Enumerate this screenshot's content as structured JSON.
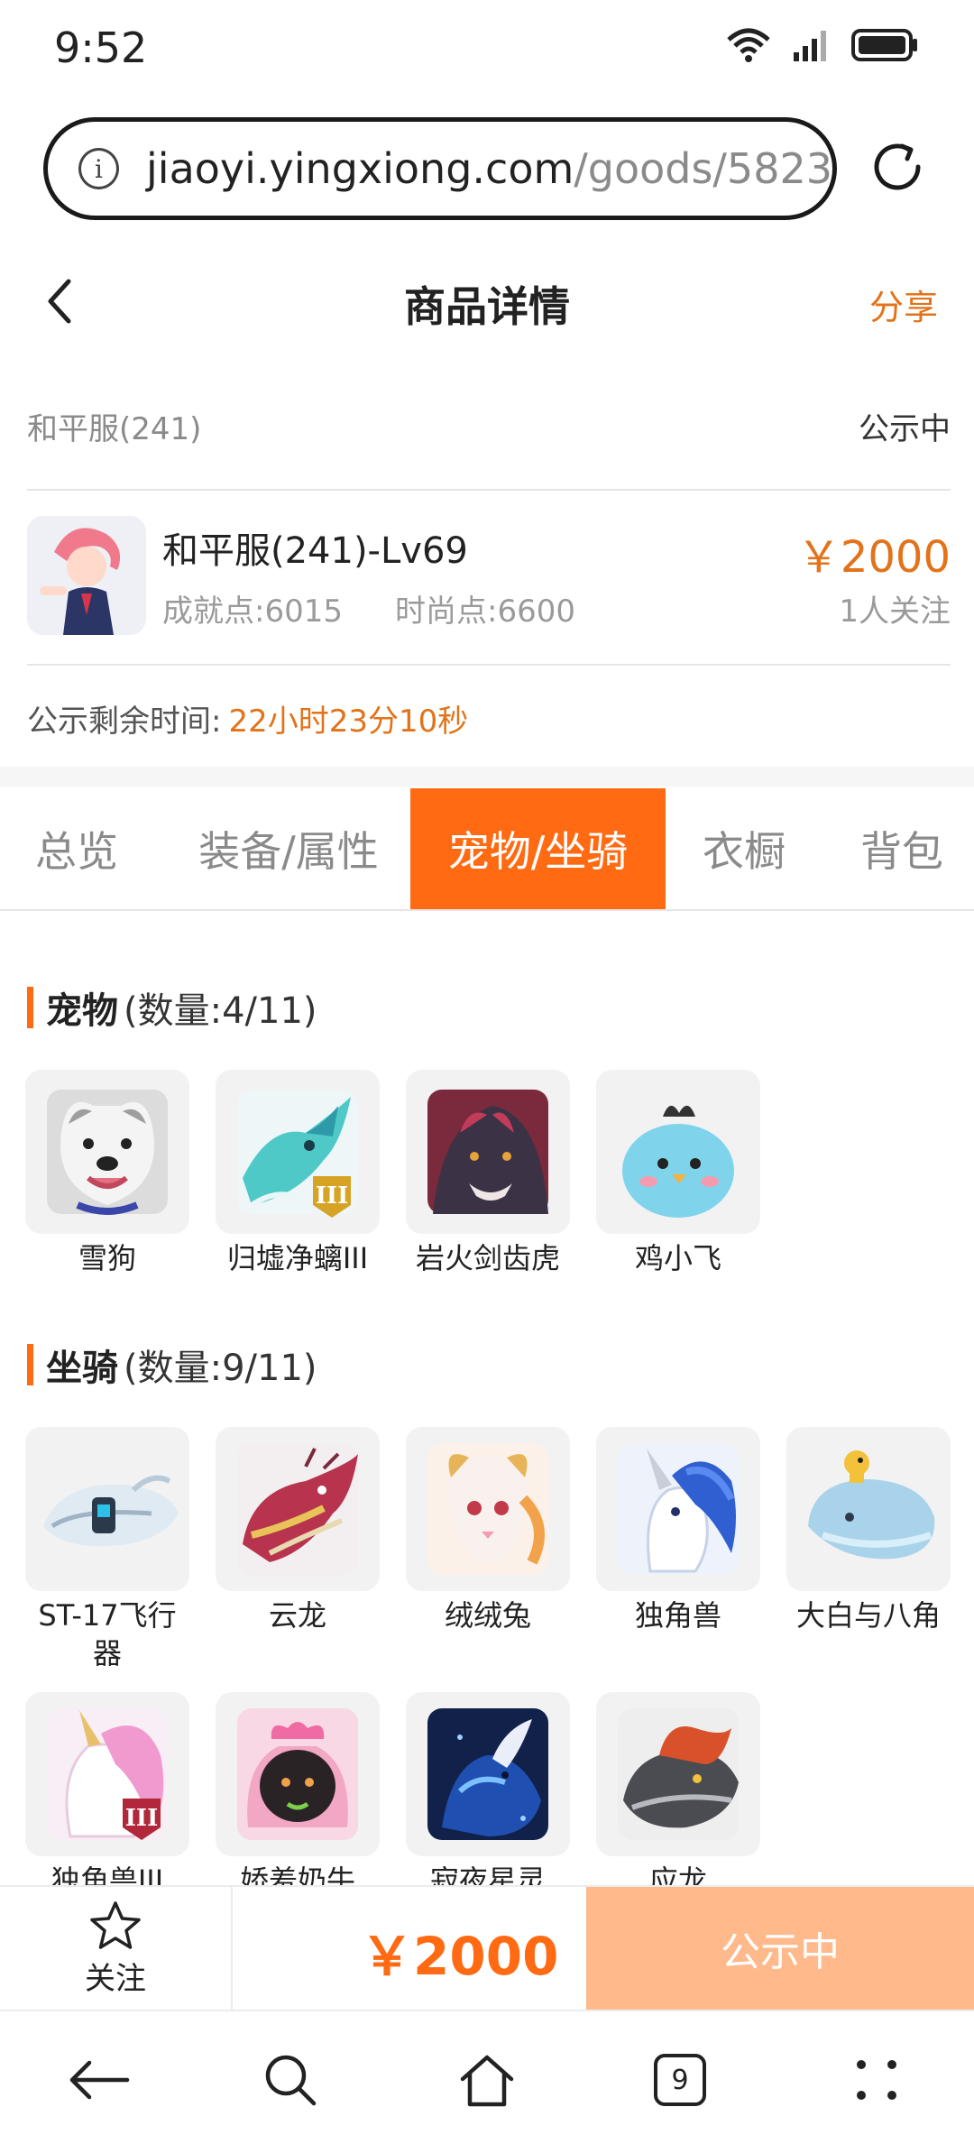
{
  "status_bar": {
    "time": "9:52"
  },
  "browser": {
    "url_host": "jiaoyi.yingxiong.com",
    "url_path": "/goods/5823",
    "tab_count": "9"
  },
  "header": {
    "title": "商品详情",
    "share": "分享"
  },
  "server": {
    "name": "和平服(241)",
    "status": "公示中"
  },
  "product": {
    "title": "和平服(241)-Lv69",
    "achievement": "成就点:6015",
    "fashion": "时尚点:6600",
    "price": "￥2000",
    "followers": "1人关注"
  },
  "timer": {
    "label": "公示剩余时间:",
    "value": "22小时23分10秒"
  },
  "tabs": [
    {
      "label": "总览",
      "active": false
    },
    {
      "label": "装备/属性",
      "active": false
    },
    {
      "label": "宠物/坐骑",
      "active": true
    },
    {
      "label": "衣橱",
      "active": false
    },
    {
      "label": "背包",
      "active": false
    }
  ],
  "pets": {
    "title": "宠物",
    "count": "(数量:4/11)",
    "items": [
      {
        "name": "雪狗"
      },
      {
        "name": "归墟净螭III"
      },
      {
        "name": "岩火剑齿虎"
      },
      {
        "name": "鸡小飞"
      }
    ]
  },
  "mounts": {
    "title": "坐骑",
    "count": "(数量:9/11)",
    "items": [
      {
        "name": "ST-17飞行器"
      },
      {
        "name": "云龙"
      },
      {
        "name": "绒绒兔"
      },
      {
        "name": "独角兽"
      },
      {
        "name": "大白与八角"
      },
      {
        "name": "独角兽III"
      },
      {
        "name": "娇羞奶牛"
      },
      {
        "name": "寂夜星灵"
      },
      {
        "name": "应龙"
      }
    ]
  },
  "action_bar": {
    "follow": "关注",
    "price": "￥2000",
    "status_button": "公示中"
  },
  "colors": {
    "accent": "#ff6a13",
    "price_text": "#e2731a",
    "disabled_button": "#ffb98a"
  }
}
